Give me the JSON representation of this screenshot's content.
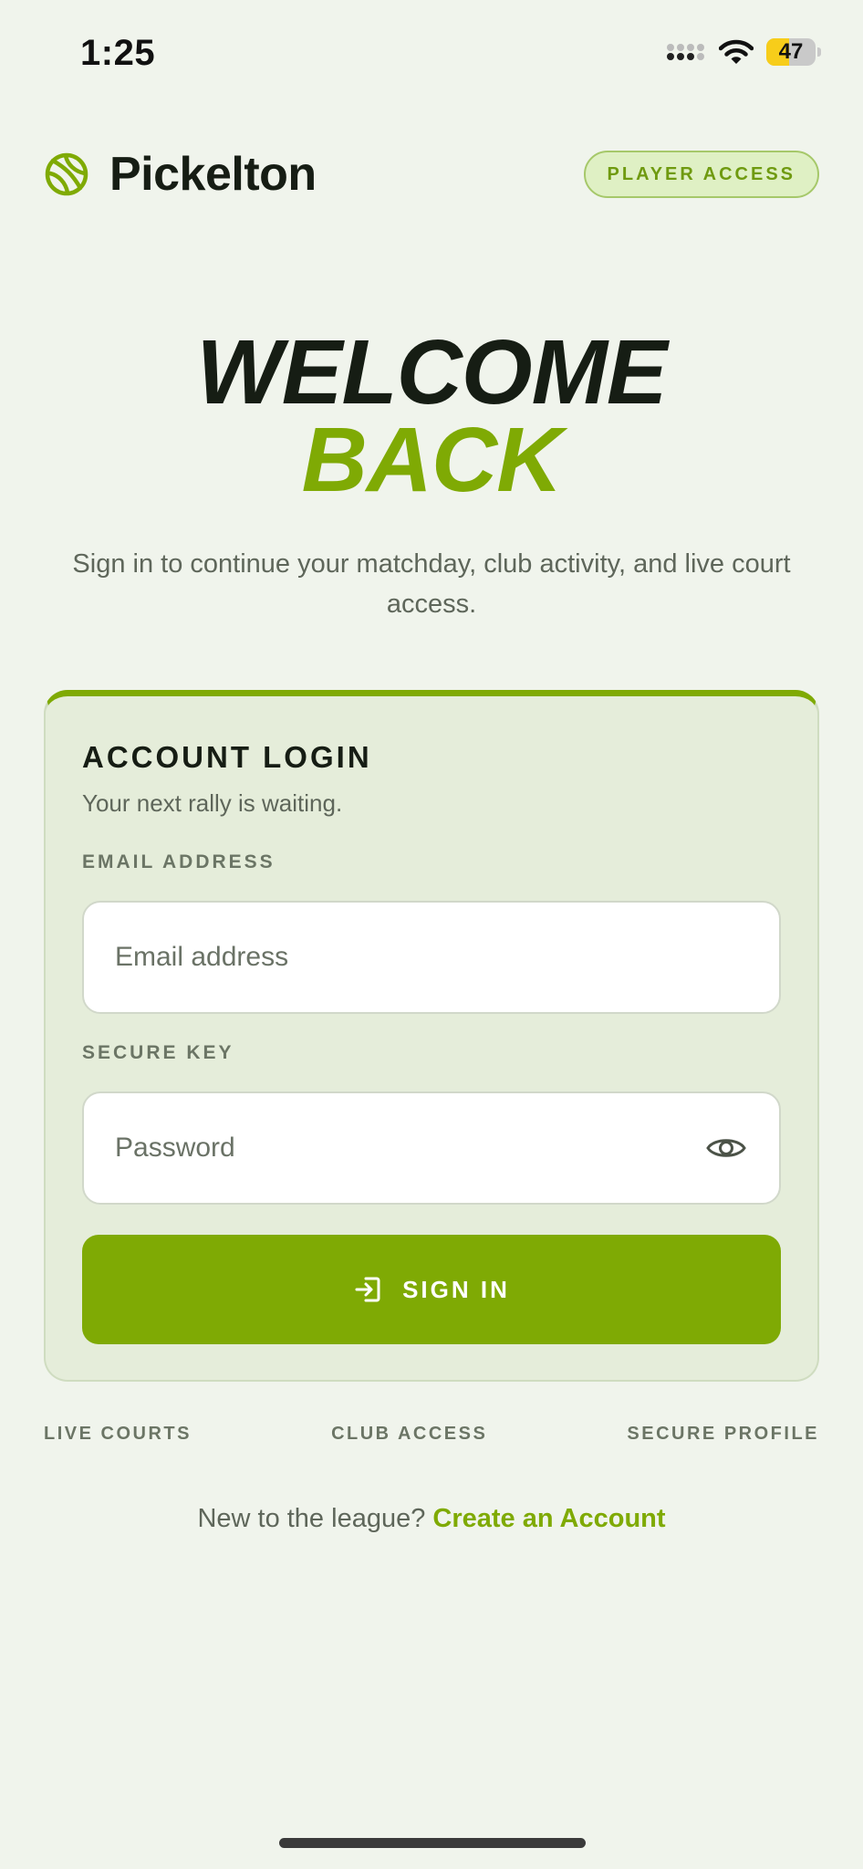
{
  "status_bar": {
    "time": "1:25",
    "battery_level": "47",
    "battery_fraction": 0.47
  },
  "header": {
    "brand_name": "Pickelton",
    "badge": "PLAYER ACCESS"
  },
  "hero": {
    "line1": "WELCOME",
    "line2": "BACK",
    "subtitle": "Sign in to continue your matchday, club activity, and live court access."
  },
  "login_card": {
    "title": "ACCOUNT LOGIN",
    "subtitle": "Your next rally is waiting.",
    "email_label": "EMAIL ADDRESS",
    "email_placeholder": "Email address",
    "email_value": "",
    "password_label": "SECURE KEY",
    "password_placeholder": "Password",
    "password_value": "",
    "submit_label": "SIGN IN"
  },
  "features": [
    "LIVE COURTS",
    "CLUB ACCESS",
    "SECURE PROFILE"
  ],
  "footer": {
    "prompt": "New to the league?",
    "link": "Create an Account"
  },
  "colors": {
    "accent": "#7faa04",
    "background": "#f0f4ec",
    "card": "#e5edda",
    "text_dark": "#161d14"
  },
  "icons": {
    "brand": "pickleball-icon",
    "signal": "cellular-signal-icon",
    "wifi": "wifi-icon",
    "battery": "battery-icon",
    "password_toggle": "eye-icon",
    "submit": "sign-in-arrow-icon"
  }
}
